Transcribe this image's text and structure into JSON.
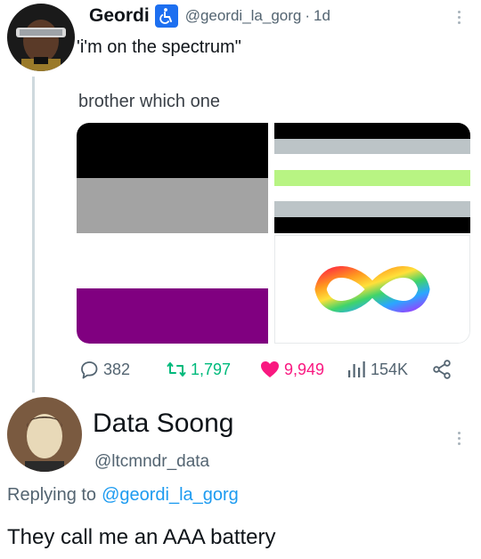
{
  "tweet": {
    "author_name": "Geordi",
    "handle": "@geordi_la_gorg",
    "separator": "·",
    "time": "1d",
    "text": "'i'm on the spectrum\"",
    "quote_text": "brother which one",
    "stats": {
      "replies": "382",
      "reposts": "1,797",
      "likes": "9,949",
      "views": "154K"
    }
  },
  "reply": {
    "author_name": "Data Soong",
    "handle": "@ltcmndr_data",
    "replying_label": "Replying to",
    "replying_to": "@geordi_la_gorg",
    "text": "They call me an AAA battery"
  },
  "media": {
    "flag_asexual": [
      "#000000",
      "#a3a3a3",
      "#ffffff",
      "#800080"
    ],
    "flag_agender": [
      "#000000",
      "#bcc4c7",
      "#ffffff",
      "#b8f483",
      "#ffffff",
      "#bcc4c7",
      "#000000"
    ],
    "icon": "infinity-rainbow-icon"
  },
  "colors": {
    "accent": "#1d9bf0",
    "like": "#f91880",
    "repost": "#00ba7c",
    "muted": "#536471",
    "badge": "#1d6ff0"
  }
}
